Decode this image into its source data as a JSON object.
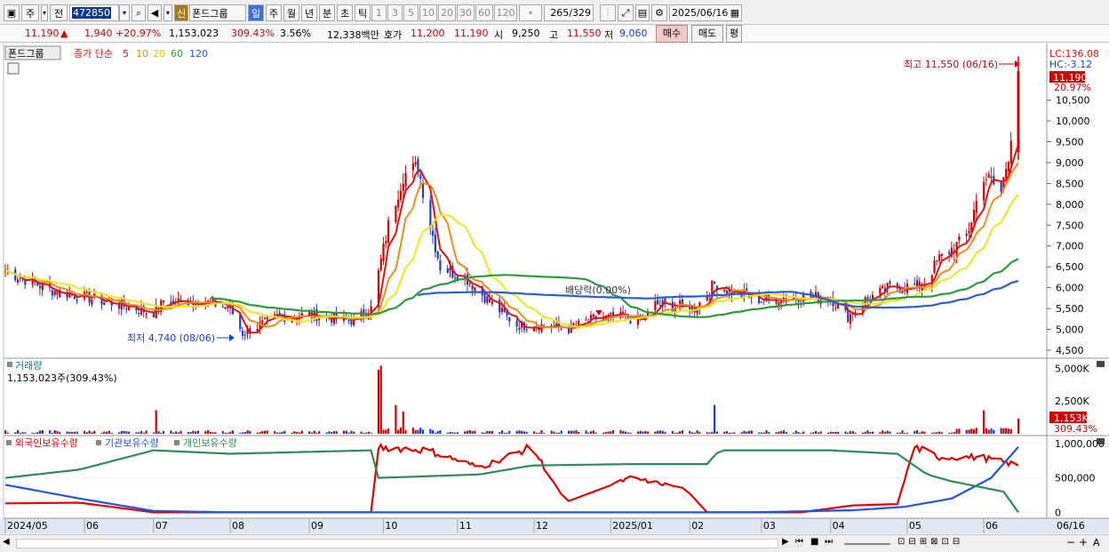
{
  "toolbar": {
    "market_tab": "주",
    "prev_label": "전",
    "code": "472850",
    "credit_badge": "신",
    "stock_name": "폰드그룹",
    "period_day": "일",
    "period_week": "주",
    "period_month": "월",
    "period_year": "년",
    "period_minute": "분",
    "period_second": "초",
    "period_tick": "틱",
    "intervals": [
      "1",
      "3",
      "5",
      "10",
      "20",
      "30",
      "60",
      "120"
    ],
    "count": "265",
    "count_total": "/329",
    "date": "2025/06/16"
  },
  "quote": {
    "price": "11,190",
    "change": "1,940",
    "change_pct": "+20.97%",
    "volume": "1,153,023",
    "volume_ratio": "309.43%",
    "turnover": "3.56%",
    "amount": "12,338백만",
    "bid_label": "호가",
    "bid": "11,200",
    "ask": "11,190",
    "open_label": "시",
    "open": "9,250",
    "high_label": "고",
    "high": "11,550",
    "low_label": "저",
    "low": "9,060",
    "buy_button": "매수",
    "sell_button": "매도",
    "eval_button": "평"
  },
  "colors": {
    "up": "#d20000",
    "down": "#1a3fd6",
    "ma5": "#e31212",
    "ma10": "#f08a1c",
    "ma20": "#f2e31a",
    "ma60": "#2a9a3a",
    "ma120": "#2b5bd7",
    "foreign": "#e00000",
    "institution": "#2255dd",
    "individual": "#2e8b57"
  },
  "chart_data": [
    {
      "type": "candlestick",
      "name": "price",
      "legend": {
        "stock": "폰드그룹",
        "label": "종가 단순",
        "periods": [
          "5",
          "10",
          "20",
          "60",
          "120"
        ]
      },
      "right_info": {
        "lc": "LC:136.08",
        "hc": "HC:-3.12",
        "last": "11,190",
        "last_pct": "20.97%"
      },
      "y_ticks": [
        4500,
        5000,
        5500,
        6000,
        6500,
        7000,
        7500,
        8000,
        8500,
        9000,
        9500,
        10000,
        10500
      ],
      "y_tick_labels": [
        "4,500",
        "5,000",
        "5,500",
        "6,000",
        "6,500",
        "7,000",
        "7,500",
        "8,000",
        "8,500",
        "9,000",
        "9,500",
        "10,000",
        "10,500"
      ],
      "ylim": [
        4350,
        11750
      ],
      "x_labels": [
        "2024/05",
        "06",
        "07",
        "08",
        "09",
        "10",
        "11",
        "12",
        "2025/01",
        "02",
        "03",
        "04",
        "05",
        "06",
        "06/16"
      ],
      "annotations": {
        "high": "최고 11,550 (06/16)",
        "low": "최저 4,740 (08/06)",
        "dividend": "배당락(0.00%)"
      },
      "close_series": [
        [
          "2024-05-02",
          6400
        ],
        [
          "2024-05-20",
          5950
        ],
        [
          "2024-06-05",
          5750
        ],
        [
          "2024-06-20",
          5550
        ],
        [
          "2024-07-01",
          5400
        ],
        [
          "2024-07-05",
          5650
        ],
        [
          "2024-07-20",
          5700
        ],
        [
          "2024-08-01",
          5500
        ],
        [
          "2024-08-06",
          4900
        ],
        [
          "2024-08-20",
          5300
        ],
        [
          "2024-09-02",
          5350
        ],
        [
          "2024-09-20",
          5200
        ],
        [
          "2024-09-27",
          5500
        ],
        [
          "2024-10-04",
          7500
        ],
        [
          "2024-10-10",
          8700
        ],
        [
          "2024-10-16",
          8900
        ],
        [
          "2024-10-21",
          7500
        ],
        [
          "2024-10-25",
          6500
        ],
        [
          "2024-11-05",
          6200
        ],
        [
          "2024-11-15",
          5600
        ],
        [
          "2024-11-25",
          5100
        ],
        [
          "2024-12-05",
          5100
        ],
        [
          "2024-12-16",
          5000
        ],
        [
          "2024-12-26",
          5250
        ],
        [
          "2025-01-06",
          5300
        ],
        [
          "2025-01-15",
          5200
        ],
        [
          "2025-01-20",
          5600
        ],
        [
          "2025-01-31",
          5550
        ],
        [
          "2025-02-05",
          5500
        ],
        [
          "2025-02-13",
          6100
        ],
        [
          "2025-02-20",
          5900
        ],
        [
          "2025-03-04",
          5700
        ],
        [
          "2025-03-20",
          5800
        ],
        [
          "2025-04-01",
          5750
        ],
        [
          "2025-04-08",
          5300
        ],
        [
          "2025-04-15",
          5700
        ],
        [
          "2025-04-25",
          6000
        ],
        [
          "2025-05-08",
          6050
        ],
        [
          "2025-05-15",
          6700
        ],
        [
          "2025-05-26",
          7200
        ],
        [
          "2025-06-02",
          8700
        ],
        [
          "2025-06-09",
          8300
        ],
        [
          "2025-06-12",
          9200
        ],
        [
          "2025-06-16",
          11190
        ]
      ]
    },
    {
      "type": "bar",
      "name": "volume",
      "title": "거래량",
      "info": "1,153,023주(309.43%)",
      "y_tick_labels": [
        "5,000K",
        "2,500K"
      ],
      "y_ticks": [
        5000,
        2500
      ],
      "ylim": [
        0,
        5500
      ],
      "last_label": "1,153K",
      "last_pct": "309.43%",
      "spikes": [
        [
          "2024-07-02",
          1800
        ],
        [
          "2024-09-30",
          4900
        ],
        [
          "2024-10-01",
          5200
        ],
        [
          "2024-10-07",
          2200
        ],
        [
          "2024-10-10",
          1700
        ],
        [
          "2025-02-13",
          2200
        ],
        [
          "2025-06-02",
          1800
        ],
        [
          "2025-06-16",
          1153
        ]
      ]
    },
    {
      "type": "line",
      "name": "holdings",
      "legend": [
        "외국인보유수량",
        "기관보유수량",
        "개인보유수량"
      ],
      "y_ticks": [
        1000000,
        500000,
        0
      ],
      "y_tick_labels": [
        "1,000,000",
        "500,000",
        "0"
      ],
      "ylim": [
        -60000,
        1050000
      ],
      "series": [
        {
          "name": "외국인보유수량",
          "values": [
            [
              "2024-05-02",
              130000
            ],
            [
              "2024-06-01",
              140000
            ],
            [
              "2024-07-01",
              0
            ],
            [
              "2024-08-01",
              0
            ],
            [
              "2024-09-27",
              0
            ],
            [
              "2024-09-30",
              950000
            ],
            [
              "2024-10-20",
              900000
            ],
            [
              "2024-11-10",
              650000
            ],
            [
              "2024-12-01",
              950000
            ],
            [
              "2024-12-15",
              150000
            ],
            [
              "2025-01-10",
              500000
            ],
            [
              "2025-02-01",
              350000
            ],
            [
              "2025-02-10",
              0
            ],
            [
              "2025-03-20",
              0
            ],
            [
              "2025-04-10",
              100000
            ],
            [
              "2025-04-28",
              120000
            ],
            [
              "2025-05-05",
              950000
            ],
            [
              "2025-05-15",
              800000
            ],
            [
              "2025-06-01",
              800000
            ],
            [
              "2025-06-16",
              680000
            ]
          ]
        },
        {
          "name": "기관보유수량",
          "values": [
            [
              "2024-05-02",
              400000
            ],
            [
              "2024-06-01",
              200000
            ],
            [
              "2024-07-01",
              20000
            ],
            [
              "2024-08-01",
              0
            ],
            [
              "2024-09-30",
              0
            ],
            [
              "2024-12-01",
              0
            ],
            [
              "2025-03-01",
              0
            ],
            [
              "2025-04-10",
              30000
            ],
            [
              "2025-05-01",
              80000
            ],
            [
              "2025-05-20",
              200000
            ],
            [
              "2025-06-05",
              500000
            ],
            [
              "2025-06-16",
              950000
            ]
          ]
        },
        {
          "name": "개인보유수량",
          "values": [
            [
              "2024-05-02",
              500000
            ],
            [
              "2024-06-01",
              620000
            ],
            [
              "2024-07-01",
              900000
            ],
            [
              "2024-08-01",
              850000
            ],
            [
              "2024-09-27",
              900000
            ],
            [
              "2024-09-30",
              500000
            ],
            [
              "2024-11-10",
              550000
            ],
            [
              "2024-12-01",
              680000
            ],
            [
              "2025-01-10",
              700000
            ],
            [
              "2025-02-10",
              700000
            ],
            [
              "2025-02-15",
              900000
            ],
            [
              "2025-04-01",
              900000
            ],
            [
              "2025-04-28",
              850000
            ],
            [
              "2025-05-10",
              550000
            ],
            [
              "2025-05-20",
              450000
            ],
            [
              "2025-06-10",
              300000
            ],
            [
              "2025-06-16",
              0
            ]
          ]
        }
      ]
    }
  ]
}
